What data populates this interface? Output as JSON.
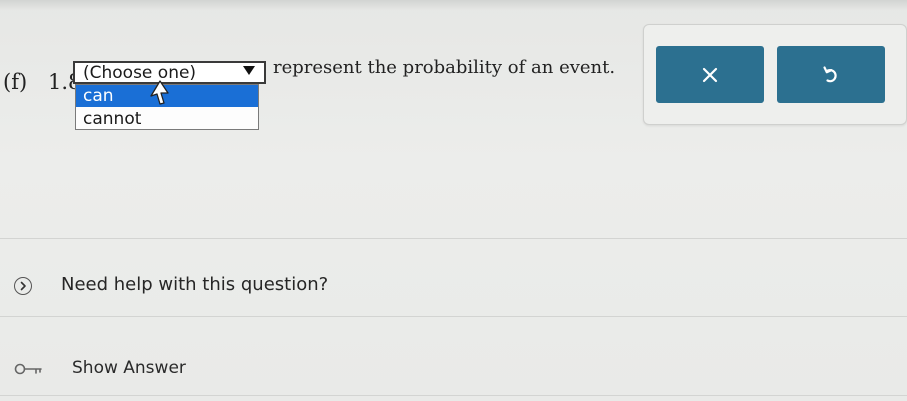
{
  "question": {
    "prefix": "(f)",
    "value": "1.89",
    "suffix": "represent the probability of an event."
  },
  "dropdown": {
    "selected_label": "(Choose one)",
    "options": [
      {
        "label": "can",
        "highlighted": true
      },
      {
        "label": "cannot",
        "highlighted": false
      }
    ]
  },
  "buttons": {
    "clear_icon": "close-icon",
    "undo_icon": "undo-icon"
  },
  "help": {
    "label": "Need help with this question?"
  },
  "answer": {
    "label": "Show Answer"
  },
  "colors": {
    "button_bg": "#2c7090",
    "option_highlight": "#1a6fd6"
  }
}
